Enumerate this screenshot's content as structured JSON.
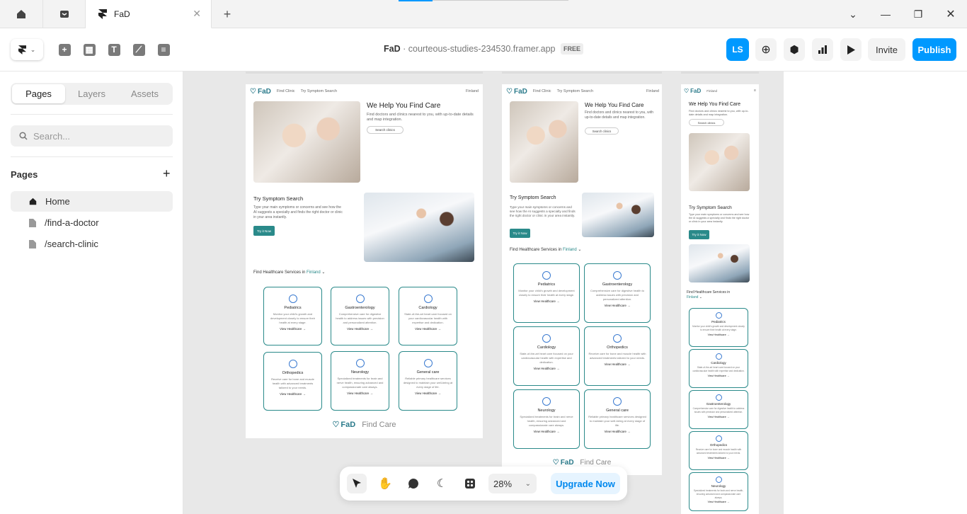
{
  "tabs": {
    "doc_title": "FaD"
  },
  "header": {
    "project": "FaD",
    "sep": "·",
    "url": "courteous-studies-234530.framer.app",
    "plan": "FREE",
    "avatar": "LS",
    "invite": "Invite",
    "publish": "Publish"
  },
  "sidebar": {
    "tabs": [
      "Pages",
      "Layers",
      "Assets"
    ],
    "search_placeholder": "Search...",
    "pages_title": "Pages",
    "pages": [
      "Home",
      "/find-a-doctor",
      "/search-clinic"
    ]
  },
  "site": {
    "brand": "FaD",
    "nav": [
      "Find Clinic",
      "Try Symptom Search"
    ],
    "country": "Finland",
    "hero_title": "We Help You Find Care",
    "hero_text": "Find doctors and clinics nearest to you, with up-to-date details and map integration.",
    "search_btn": "Search clinics",
    "symptom_title": "Try Symptom Search",
    "symptom_text": "Type your main symptoms or concerns and see how the AI suggests a specialty and finds the right doctor or clinic in your area instantly.",
    "try_btn": "Try it Now",
    "services_prefix": "Find Healthcare Services in",
    "services_country": "Finland",
    "view": "View Healthcare",
    "footer_brand": "FaD",
    "footer_tag": "Find Care",
    "cards": [
      {
        "title": "Pediatrics",
        "desc": "Monitor your child's growth and development closely to ensure their health at every stage."
      },
      {
        "title": "Gastroenterology",
        "desc": "Comprehensive care for digestive health to address issues with precision and personalized attention."
      },
      {
        "title": "Cardiology",
        "desc": "State-of-the-art heart care focused on your cardiovascular health with expertise and dedication."
      },
      {
        "title": "Orthopedics",
        "desc": "Receive care for bone and muscle health with advanced treatments tailored to your needs."
      },
      {
        "title": "Neurology",
        "desc": "Specialized treatments for brain and nerve health, ensuring advanced and compassionate care always."
      },
      {
        "title": "General care",
        "desc": "Reliable primary healthcare services designed to maintain your well-being at every stage of life."
      }
    ]
  },
  "bottombar": {
    "zoom": "28%",
    "upgrade": "Upgrade Now"
  },
  "colors": {
    "accent": "#0099ff",
    "teal": "#2a8a8a"
  }
}
